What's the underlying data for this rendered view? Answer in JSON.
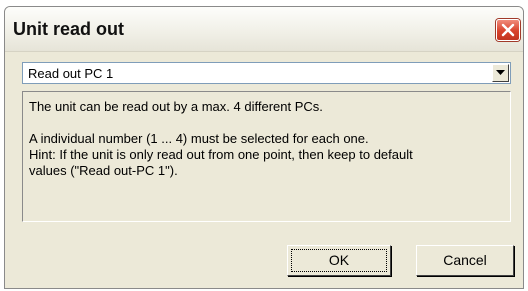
{
  "window": {
    "title": "Unit read out"
  },
  "icons": {
    "close": "close-icon",
    "dropdown": "chevron-down-icon"
  },
  "select": {
    "value": "Read out PC 1"
  },
  "info": {
    "line1": "The unit can be read out by a max. 4 different PCs.",
    "line2": "A individual number (1 ... 4) must be selected for each one.",
    "line3": "Hint: If the unit is only read out from one point, then keep to default",
    "line4": "values (\"Read out-PC 1\")."
  },
  "buttons": {
    "ok": "OK",
    "cancel": "Cancel"
  },
  "colors": {
    "close_red": "#d8432c",
    "dialog_bg": "#ece9d8"
  }
}
